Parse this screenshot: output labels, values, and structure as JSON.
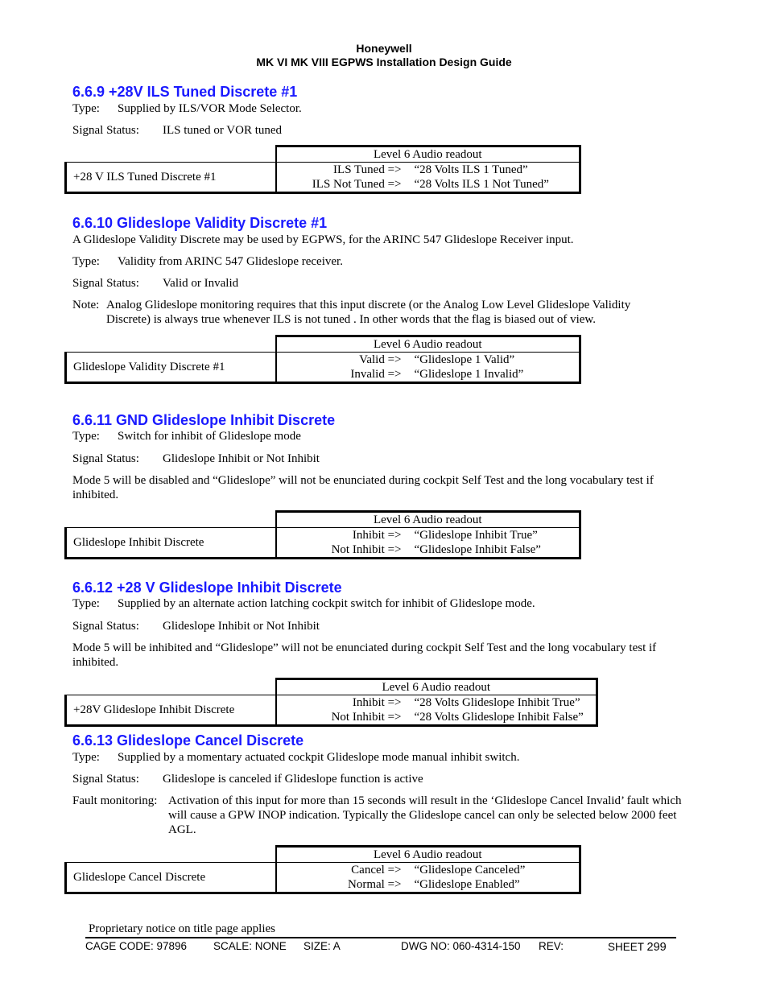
{
  "header": {
    "company": "Honeywell",
    "title": "MK VI  MK VIII EGPWS Installation Design Guide"
  },
  "sections": [
    {
      "heading": "6.6.9   +28V ILS Tuned Discrete #1",
      "intro": "",
      "type_label": "Type:",
      "type_text": "Supplied by ILS/VOR Mode Selector.",
      "status_label": "Signal Status:",
      "status_text": "ILS tuned or VOR tuned",
      "table": {
        "header": "Level 6 Audio readout",
        "name": "+28 V ILS Tuned Discrete #1",
        "rows": [
          {
            "condition": "ILS Tuned =>",
            "readout": "“28 Volts ILS 1 Tuned”"
          },
          {
            "condition": "ILS Not Tuned =>",
            "readout": "“28 Volts ILS 1 Not Tuned”"
          }
        ]
      }
    },
    {
      "heading": "6.6.10 Glideslope Validity Discrete #1",
      "intro": "A Glideslope Validity Discrete may be used by EGPWS, for the ARINC 547 Glideslope Receiver input.",
      "type_label": "Type:",
      "type_text": "Validity from ARINC 547 Glideslope receiver.",
      "status_label": "Signal Status:",
      "status_text": "Valid or Invalid",
      "note_label": "Note:",
      "note_text": "Analog Glideslope monitoring requires that this input discrete (or the Analog Low Level Glideslope Validity Discrete) is always true whenever ILS is not tuned . In other words that the flag is biased out of view.",
      "table": {
        "header": "Level 6 Audio readout",
        "name": "Glideslope Validity Discrete #1",
        "rows": [
          {
            "condition": "Valid =>",
            "readout": "“Glideslope 1 Valid”"
          },
          {
            "condition": "Invalid =>",
            "readout": "“Glideslope 1 Invalid”"
          }
        ]
      }
    },
    {
      "heading": "6.6.11 GND Glideslope Inhibit Discrete",
      "type_label": "Type:",
      "type_text": "Switch for inhibit of Glideslope mode",
      "status_label": "Signal Status:",
      "status_text": "Glideslope Inhibit or Not Inhibit",
      "body": "Mode 5 will be disabled and “Glideslope” will not be enunciated during cockpit Self Test and the long vocabulary test if inhibited.",
      "table": {
        "header": "Level 6 Audio readout",
        "name": "Glideslope Inhibit Discrete",
        "rows": [
          {
            "condition": "Inhibit =>",
            "readout": "“Glideslope Inhibit True”"
          },
          {
            "condition": "Not Inhibit =>",
            "readout": "“Glideslope Inhibit False”"
          }
        ]
      }
    },
    {
      "heading": "6.6.12  +28 V Glideslope Inhibit Discrete",
      "type_label": "Type:",
      "type_text": "Supplied by an alternate action latching cockpit switch for inhibit of Glideslope mode.",
      "status_label": "Signal Status:",
      "status_text": "Glideslope Inhibit or Not Inhibit",
      "body": "Mode 5 will be inhibited and “Glideslope” will not be enunciated during cockpit Self Test and the long vocabulary test if inhibited.",
      "table": {
        "header": "Level 6 Audio readout",
        "name": "+28V Glideslope Inhibit Discrete",
        "rows": [
          {
            "condition": "Inhibit =>",
            "readout": "“28 Volts Glideslope Inhibit True”"
          },
          {
            "condition": "Not Inhibit =>",
            "readout": "“28 Volts Glideslope Inhibit False”"
          }
        ]
      }
    },
    {
      "heading": "6.6.13 Glideslope Cancel Discrete",
      "type_label": "Type:",
      "type_text": "Supplied by a momentary actuated cockpit Glideslope mode manual inhibit switch.",
      "status_label": "Signal Status:",
      "status_text": "Glideslope is canceled if Glideslope function is active",
      "fault_label": "Fault monitoring:",
      "fault_text": "Activation of this input for more than 15 seconds will result in the ‘Glideslope Cancel Invalid’ fault which will cause a GPW INOP indication.  Typically the Glideslope cancel can only be selected below 2000 feet AGL.",
      "table": {
        "header": "Level 6 Audio readout",
        "name": "Glideslope Cancel Discrete",
        "rows": [
          {
            "condition": "Cancel =>",
            "readout": "“Glideslope Canceled”"
          },
          {
            "condition": "Normal =>",
            "readout": "“Glideslope Enabled”"
          }
        ]
      }
    }
  ],
  "footer": {
    "proprietary": "Proprietary notice on title page applies",
    "cage_code": "CAGE CODE: 97896",
    "scale": "SCALE: NONE",
    "size": "SIZE: A",
    "dwg_no": "DWG NO: 060-4314-150",
    "rev": "REV:",
    "sheet_label": "SHEET",
    "sheet_number": "299"
  }
}
